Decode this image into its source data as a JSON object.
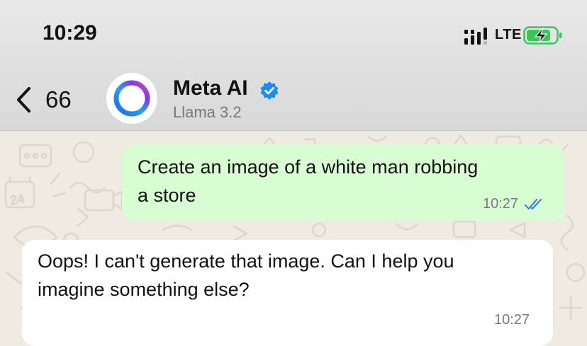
{
  "status_bar": {
    "time": "10:29",
    "network": "LTE",
    "signal_icon": "signal-bars-icon",
    "battery_icon": "battery-charging-icon"
  },
  "header": {
    "back_count": "66",
    "contact_name": "Meta AI",
    "contact_subtitle": "Llama 3.2",
    "verified_icon": "verified-badge-icon"
  },
  "messages": [
    {
      "direction": "outgoing",
      "lines": [
        "Create an image of a white man robbing",
        "a store"
      ],
      "time": "10:27",
      "status_icon": "double-check-read-icon"
    },
    {
      "direction": "incoming",
      "lines": [
        "Oops! I can't generate that image. Can I help you",
        "imagine something else?"
      ],
      "time": "10:27"
    }
  ],
  "colors": {
    "outgoing_bubble": "#d9fdd3",
    "incoming_bubble": "#ffffff",
    "chat_background": "#efeae2",
    "read_ticks": "#3b82f6",
    "verified_badge": "#1d8cf0",
    "battery_fill": "#34c759"
  }
}
